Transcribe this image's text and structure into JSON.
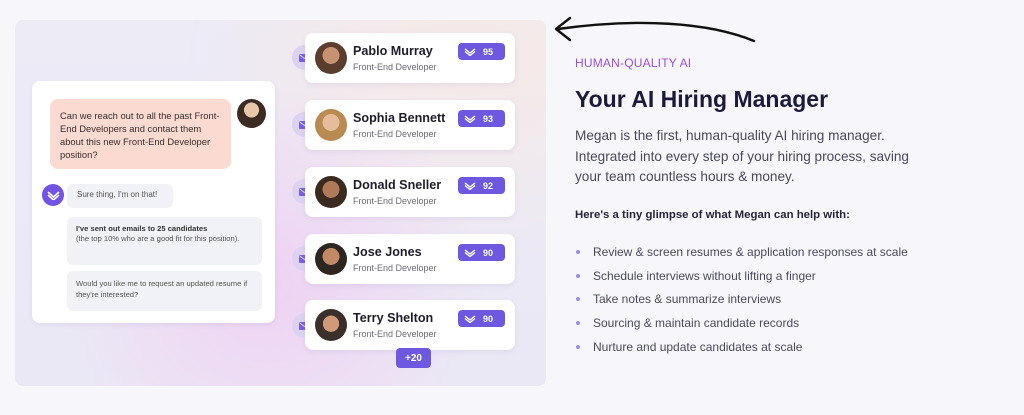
{
  "chat": {
    "user_message": "Can we reach out to all the past Front-End Developers and contact them about this new Front-End Developer position?",
    "bot_reply_1": "Sure thing, I'm on that!",
    "bot_reply_2_bold": "I've sent out emails to 25 candidates",
    "bot_reply_2_rest": "(the top 10% who are a good fit for this position).",
    "bot_reply_3": "Would you like me to request an updated resume if they're interested?"
  },
  "candidates": [
    {
      "name": "Pablo Murray",
      "role": "Front-End Developer",
      "score": "95"
    },
    {
      "name": "Sophia Bennett",
      "role": "Front-End Developer",
      "score": "93"
    },
    {
      "name": "Donald Sneller",
      "role": "Front-End Developer",
      "score": "92"
    },
    {
      "name": "Jose Jones",
      "role": "Front-End Developer",
      "score": "90"
    },
    {
      "name": "Terry Shelton",
      "role": "Front-End Developer",
      "score": "90"
    }
  ],
  "more_count": "+20",
  "hero": {
    "eyebrow": "HUMAN-QUALITY AI",
    "title": "Your AI Hiring Manager",
    "description": "Megan is the first, human-quality AI hiring manager. Integrated into every step of your hiring process, saving your team countless hours & money.",
    "features_heading": "Here's a tiny glimpse of what Megan can help with:",
    "features": [
      "Review & screen resumes & application responses at scale",
      "Schedule interviews without lifting a finger",
      "Take notes & summarize interviews",
      "Sourcing & maintain candidate records",
      "Nurture and update candidates at scale"
    ]
  },
  "colors": {
    "accent": "#6e58e0",
    "eyebrow": "#9b4fe3",
    "headline": "#1c1a3a",
    "user_bubble": "#fbdad1"
  },
  "icons": [
    "mail-icon",
    "megan-logo-icon",
    "score-logo-icon",
    "arrow-icon",
    "bullet-icon"
  ]
}
